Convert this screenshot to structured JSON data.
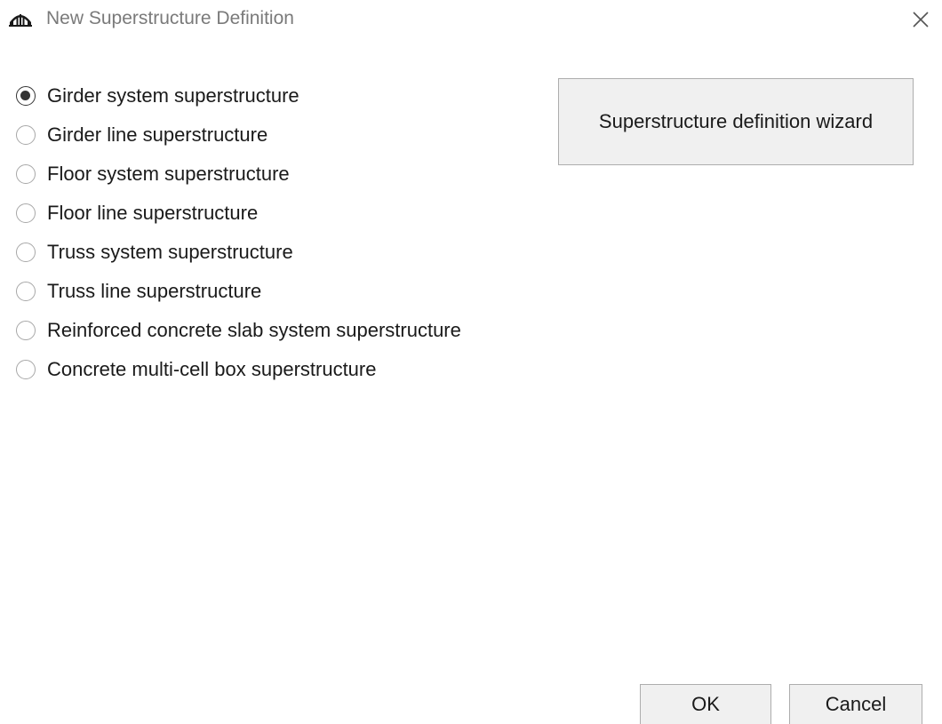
{
  "window": {
    "title": "New Superstructure Definition",
    "icon": "bridge-arch-icon",
    "close_icon": "close-icon"
  },
  "superstructure_types": [
    {
      "label": "Girder system superstructure",
      "selected": true
    },
    {
      "label": "Girder line superstructure",
      "selected": false
    },
    {
      "label": "Floor system superstructure",
      "selected": false
    },
    {
      "label": "Floor line superstructure",
      "selected": false
    },
    {
      "label": "Truss system superstructure",
      "selected": false
    },
    {
      "label": "Truss line superstructure",
      "selected": false
    },
    {
      "label": "Reinforced concrete slab system superstructure",
      "selected": false
    },
    {
      "label": "Concrete multi-cell box superstructure",
      "selected": false
    }
  ],
  "wizard_button_label": "Superstructure definition wizard",
  "footer": {
    "ok_label": "OK",
    "cancel_label": "Cancel"
  },
  "colors": {
    "background": "#ffffff",
    "button_face": "#f0f0f0",
    "button_border": "#adadad",
    "radio_checked": "#333333",
    "title_text": "#7a7a7a"
  }
}
